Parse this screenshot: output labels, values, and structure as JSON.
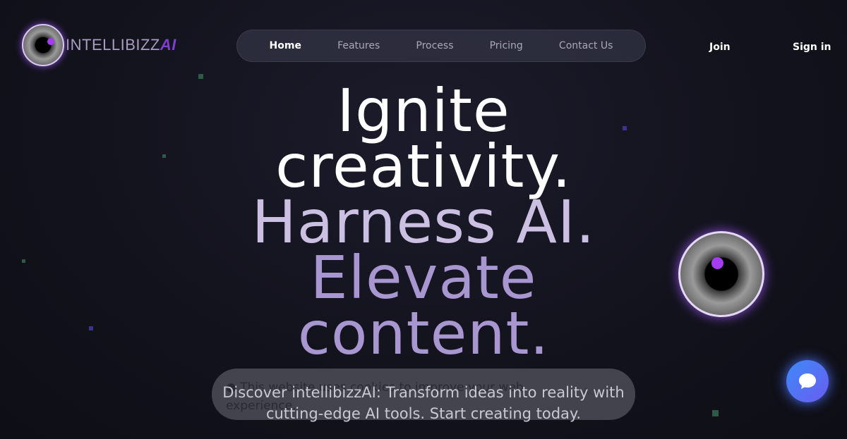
{
  "brand": {
    "name": "INTELLIBIZZ",
    "suffix": "AI"
  },
  "nav": {
    "items": [
      {
        "label": "Home",
        "active": true
      },
      {
        "label": "Features"
      },
      {
        "label": "Process"
      },
      {
        "label": "Pricing"
      },
      {
        "label": "Contact Us"
      }
    ]
  },
  "auth": {
    "join": "Join",
    "signin": "Sign in"
  },
  "hero": {
    "lines": [
      "Ignite",
      "creativity.",
      "Harness AI.",
      "Elevate",
      "content."
    ],
    "subtitle": "Discover intellibizzAI: Transform ideas into reality with cutting-edge AI tools. Start creating today."
  },
  "cookie": {
    "icon": "cookie-icon",
    "text": "This website uses cookies to improve your web experience.",
    "accept": "Accept"
  },
  "chat": {
    "icon": "chat-bubble-icon"
  },
  "colors": {
    "accent": "#a43cf0",
    "chat": "#3d8af7",
    "lavender": "#a796cf"
  }
}
